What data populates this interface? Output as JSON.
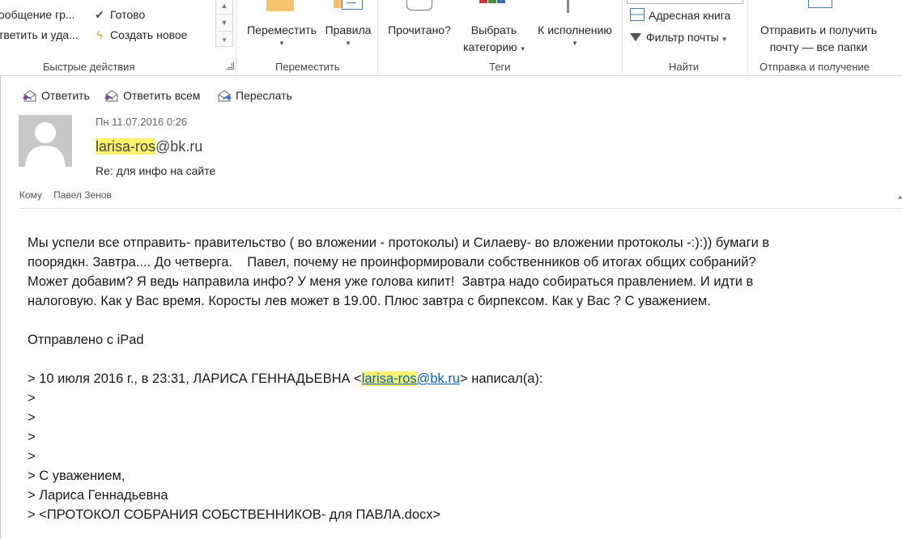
{
  "ribbon": {
    "quick_steps": {
      "items": [
        {
          "label": "ообщение гр...",
          "icon": "envelope-icon"
        },
        {
          "label": "тветить и уда...",
          "icon": "reply-delete-icon"
        }
      ],
      "items_right": [
        {
          "label": "Готово",
          "icon": "checkmark-icon"
        },
        {
          "label": "Создать новое",
          "icon": "lightning-icon"
        }
      ],
      "group_label": "Быстрые действия"
    },
    "move": {
      "move_label": "Переместить",
      "rules_label": "Правила",
      "group_label": "Переместить"
    },
    "tags": {
      "read_label": "Прочитано?",
      "categorize_line1": "Выбрать",
      "categorize_line2": "категорию",
      "followup_label": "К исполнению",
      "group_label": "Теги"
    },
    "find": {
      "address_book": "Адресная книга",
      "filter_mail": "Фильтр почты",
      "group_label": "Найти"
    },
    "send_receive": {
      "line1": "Отправить и получить",
      "line2": "почту — все папки",
      "group_label": "Отправка и получение"
    }
  },
  "reading_pane": {
    "actions": {
      "reply": "Ответить",
      "reply_all": "Ответить всем",
      "forward": "Переслать"
    },
    "header": {
      "date": "Пн 11.07.2016 0:26",
      "from_highlight": "larisa-ros",
      "from_domain": "@bk.ru",
      "subject": "Re: для инфо на сайте",
      "to_label": "Кому",
      "to_value": "Павел Зенов"
    },
    "body": {
      "lines": [
        "Мы успели все отправить- правительство ( во вложении - протоколы) и Силаеву- во вложении протоколы -:):)) бумаги в",
        "поорядкн. Завтра.... До четверга.    Павел, почему не проинформировали собственников об итогах общих собраний?",
        "Может добавим? Я ведь направила инфо? У меня уже голова кипит!  Завтра надо собираться правлением. И идти в",
        "налоговую. Как у Вас время. Коросты лев может в 19.00. Плюс завтра с бирпексом. Как у Вас ? С уважением.",
        "",
        "Отправлено с iPad",
        ""
      ],
      "quote_prefix": "> 10 июля 2016 г., в 23:31, ЛАРИСА ГЕННАДЬЕВНА <",
      "quote_email_highlight": "larisa-ros",
      "quote_email_domain": "@bk.ru",
      "quote_suffix": "> написал(а):",
      "quoted_lines": [
        ">",
        ">",
        ">",
        ">",
        "> С уважением,",
        "> Лариса Геннадьевна",
        "> <ПРОТОКОЛ СОБРАНИЯ СОБСТВЕННИКОВ- для ПАВЛА.docx>"
      ]
    }
  },
  "colors": {
    "highlight": "#fdf06b",
    "link": "#0563c1",
    "reply_icon": "#7a3fa0"
  }
}
